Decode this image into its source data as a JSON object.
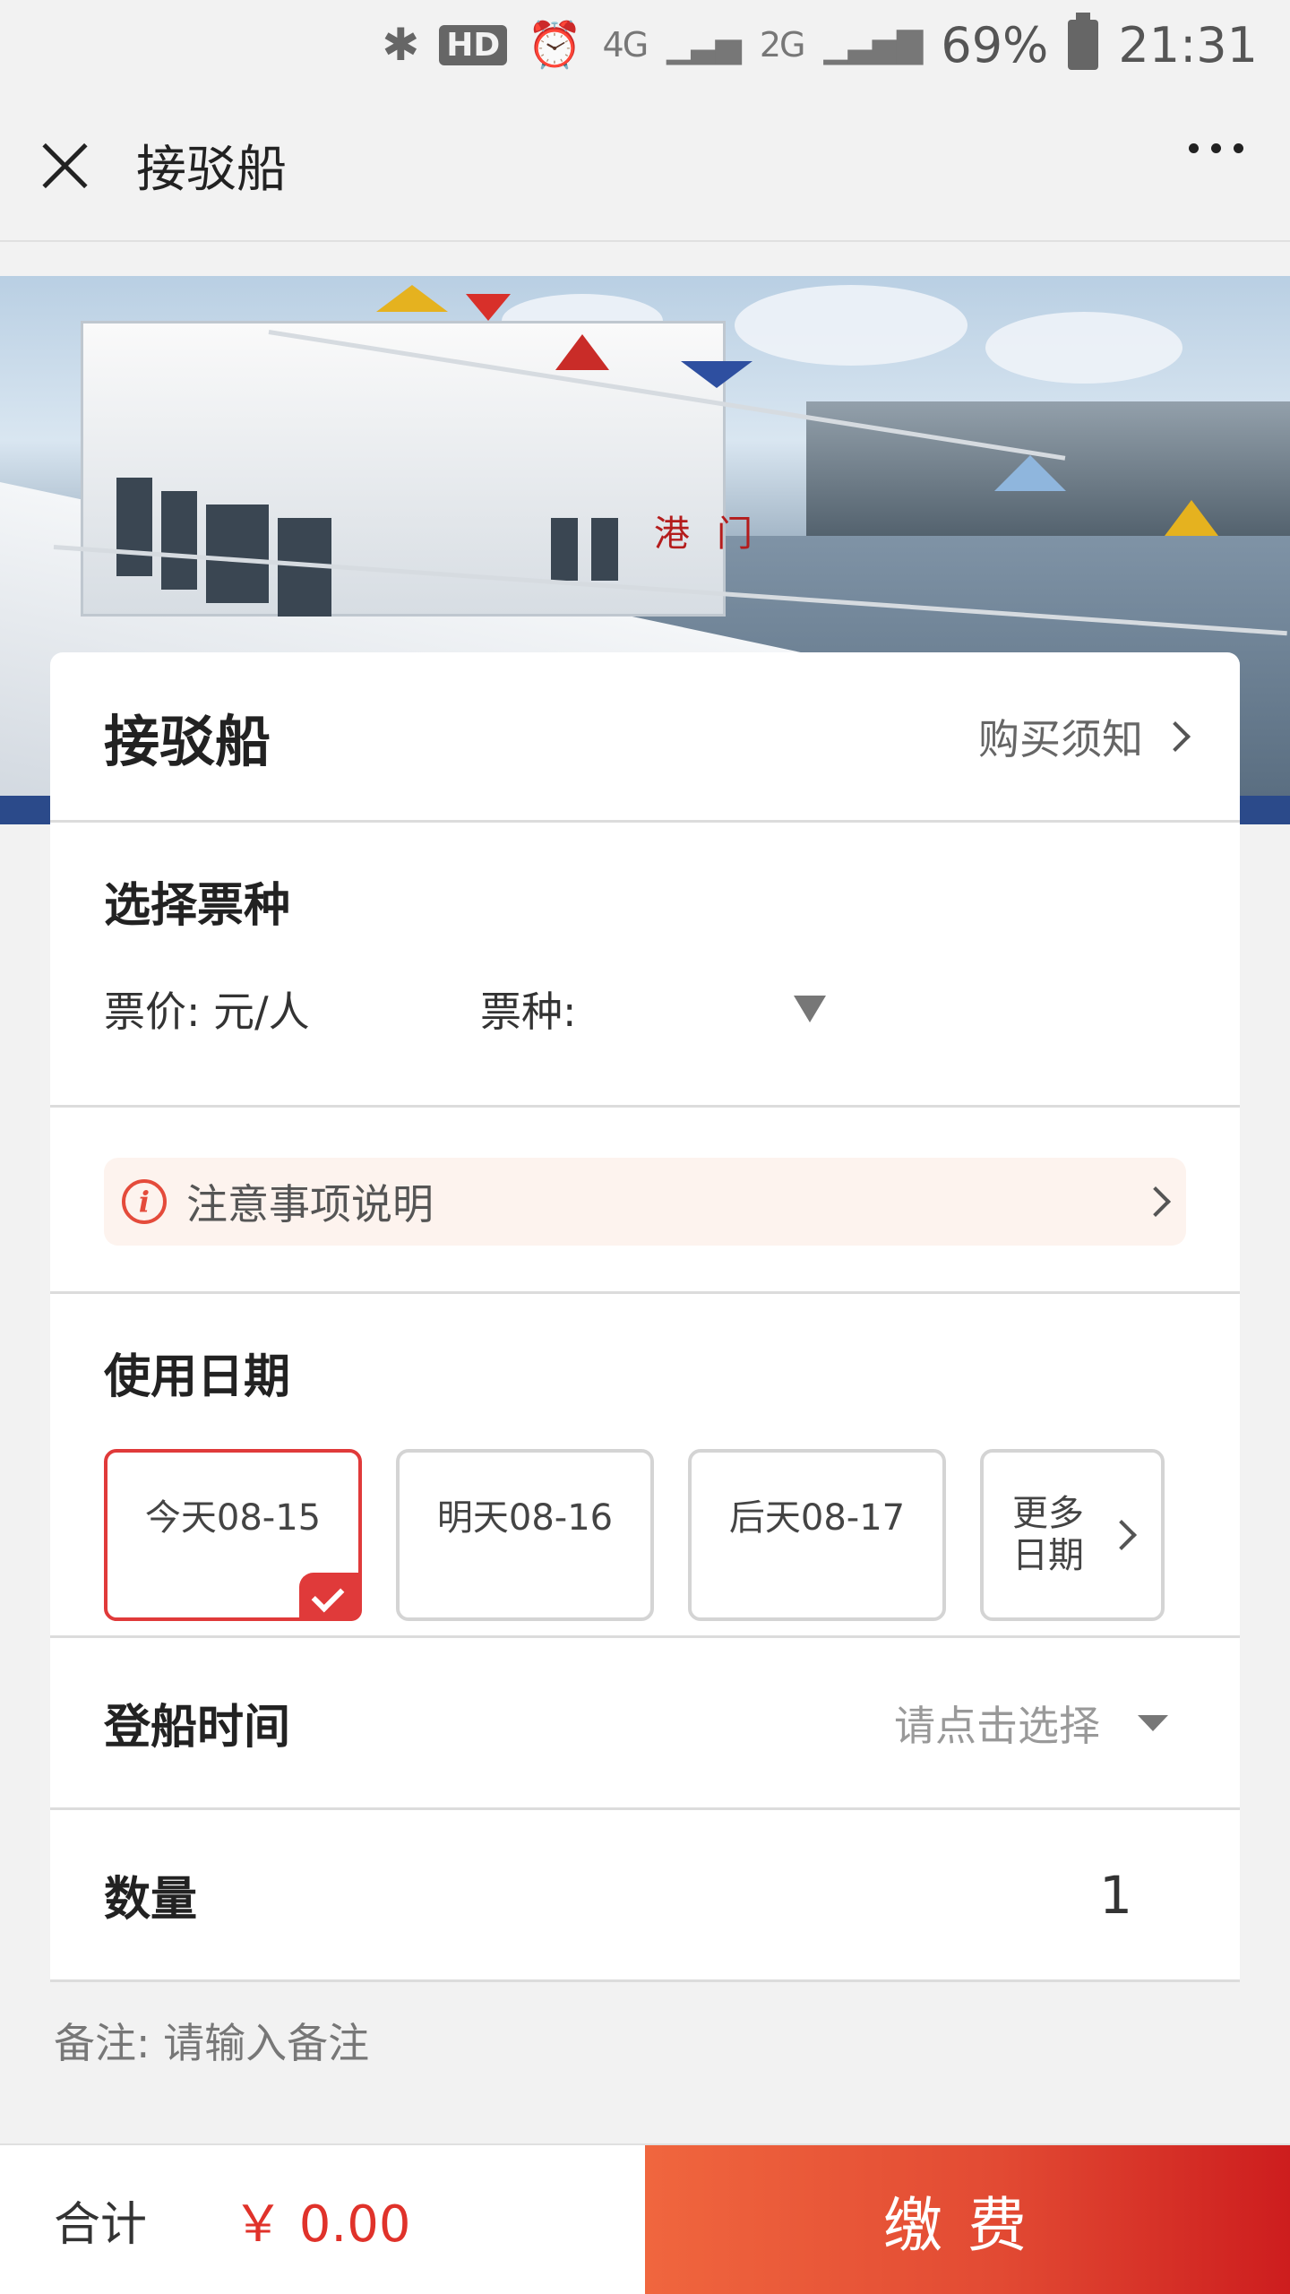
{
  "status_bar": {
    "bluetooth_icon": "bluetooth-icon",
    "hd_badge": "HD",
    "alarm_icon": "alarm-icon",
    "net1": "4G",
    "net2": "2G",
    "battery_percent": "69%",
    "time": "21:31"
  },
  "nav": {
    "close_icon": "close-icon",
    "title": "接驳船",
    "more_icon": "more-dots-icon"
  },
  "banner": {
    "sign_text": "港门"
  },
  "product": {
    "title": "接驳船",
    "notice_link": "购买须知"
  },
  "ticket": {
    "section_title": "选择票种",
    "price_label": "票价: 元/人",
    "type_label": "票种:"
  },
  "notice": {
    "text": "注意事项说明"
  },
  "date": {
    "section_title": "使用日期",
    "options": [
      {
        "label": "今天08-15",
        "selected": true
      },
      {
        "label": "明天08-16",
        "selected": false
      },
      {
        "label": "后天08-17",
        "selected": false
      }
    ],
    "more_line1": "更多",
    "more_line2": "日期"
  },
  "boarding": {
    "label": "登船时间",
    "placeholder": "请点击选择"
  },
  "quantity": {
    "label": "数量",
    "value": "1"
  },
  "remark": {
    "text": "备注: 请输入备注"
  },
  "footer": {
    "total_label": "合计",
    "total_amount": "￥ 0.00",
    "pay_button": "缴费"
  },
  "colors": {
    "accent": "#e03a3a",
    "pay_gradient_start": "#f0663e",
    "pay_gradient_end": "#cd1d1e",
    "notice_bg": "#fdf3ee"
  }
}
